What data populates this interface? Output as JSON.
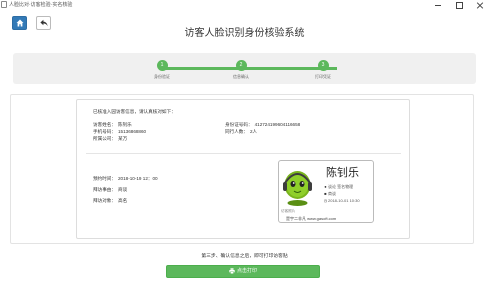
{
  "window": {
    "title": "人脸比对·访客检验·实名核验",
    "colors": {
      "primary": "#337ab7",
      "success": "#5cb85c"
    }
  },
  "toolbar": {
    "home_icon": "home-icon",
    "back_icon": "back-arrow-icon"
  },
  "header": {
    "title": "访客人脸识别身份核验系统"
  },
  "steps": [
    {
      "number": "1",
      "label": "身份验证"
    },
    {
      "number": "2",
      "label": "信息确认"
    },
    {
      "number": "3",
      "label": "打印凭证"
    }
  ],
  "notice": "已核准入园访客信息，请认真核对如下：",
  "visitor": {
    "name_label": "访客姓名：",
    "name": "陈钊乐",
    "id_label": "身份证号码：",
    "id": "412724199604116658",
    "phone_label": "手机号码：",
    "phone": "15136868860",
    "companions_label": "同行人数：",
    "companions": "2人",
    "company_label": "所属公司：",
    "company": "某万"
  },
  "appointment": {
    "time_label": "预约时间：",
    "time": "2018-10-19 12：00",
    "purpose_label": "拜访事由：",
    "purpose": "商谈",
    "host_label": "拜访对象：",
    "host": "高名"
  },
  "badge": {
    "name": "陈钊乐",
    "line1": "谈论 签名物理",
    "line2": "商谈",
    "line3": "2018-10-01 10:30",
    "caption": "访客照片",
    "url": "是宇二非凡 www.gasoft.com"
  },
  "footer": {
    "note": "第三步、确认信息之后，即可打印访客贴",
    "print_label": "点击打印"
  }
}
